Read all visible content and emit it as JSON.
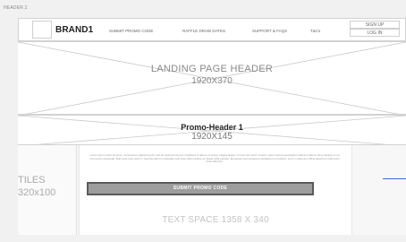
{
  "frame_label": "HEADER 2",
  "header": {
    "brand": "BRAND1",
    "nav": [
      "SUBMIT PROMO CODE",
      "RAFFLE DRAW DATES",
      "SUPPORT & FAQS",
      "T&Cs"
    ],
    "signup_label": "SIGN UP",
    "login_label": "LOG IN"
  },
  "landing": {
    "title": "LANDING PAGE HEADER",
    "size": "1920X370"
  },
  "promo_header": {
    "title": "Promo-Header 1",
    "size": "1920X145"
  },
  "tiles": {
    "label": "TILES",
    "size": "320x100"
  },
  "content": {
    "lorem": "Lorem ipsum dolor sit amet, consectetur adipiscing elit, sed do eiusmod tempor incididunt ut labore et dolore magna aliqua. Ut enim ad minim veniam, quis nostrud exercitation ullamco laboris nisi ut aliquip ex ea commodo consequat. Duis aute irure dolor in reprehenderit in voluptate velit esse cillum dolore eu fugiat nulla pariatur. Excepteur sint occaecat cupidatat non proident, sunt in culpa qui officia deserunt mollit anim id est laborum.",
    "submit_button": "SUBMIT PROMO CODE",
    "text_space": "TEXT SPACE 1358 X 340"
  },
  "colors": {
    "accent_blue": "#3a6fd4",
    "button_fill": "#9d9d9d",
    "button_border": "#5a5a5a"
  }
}
